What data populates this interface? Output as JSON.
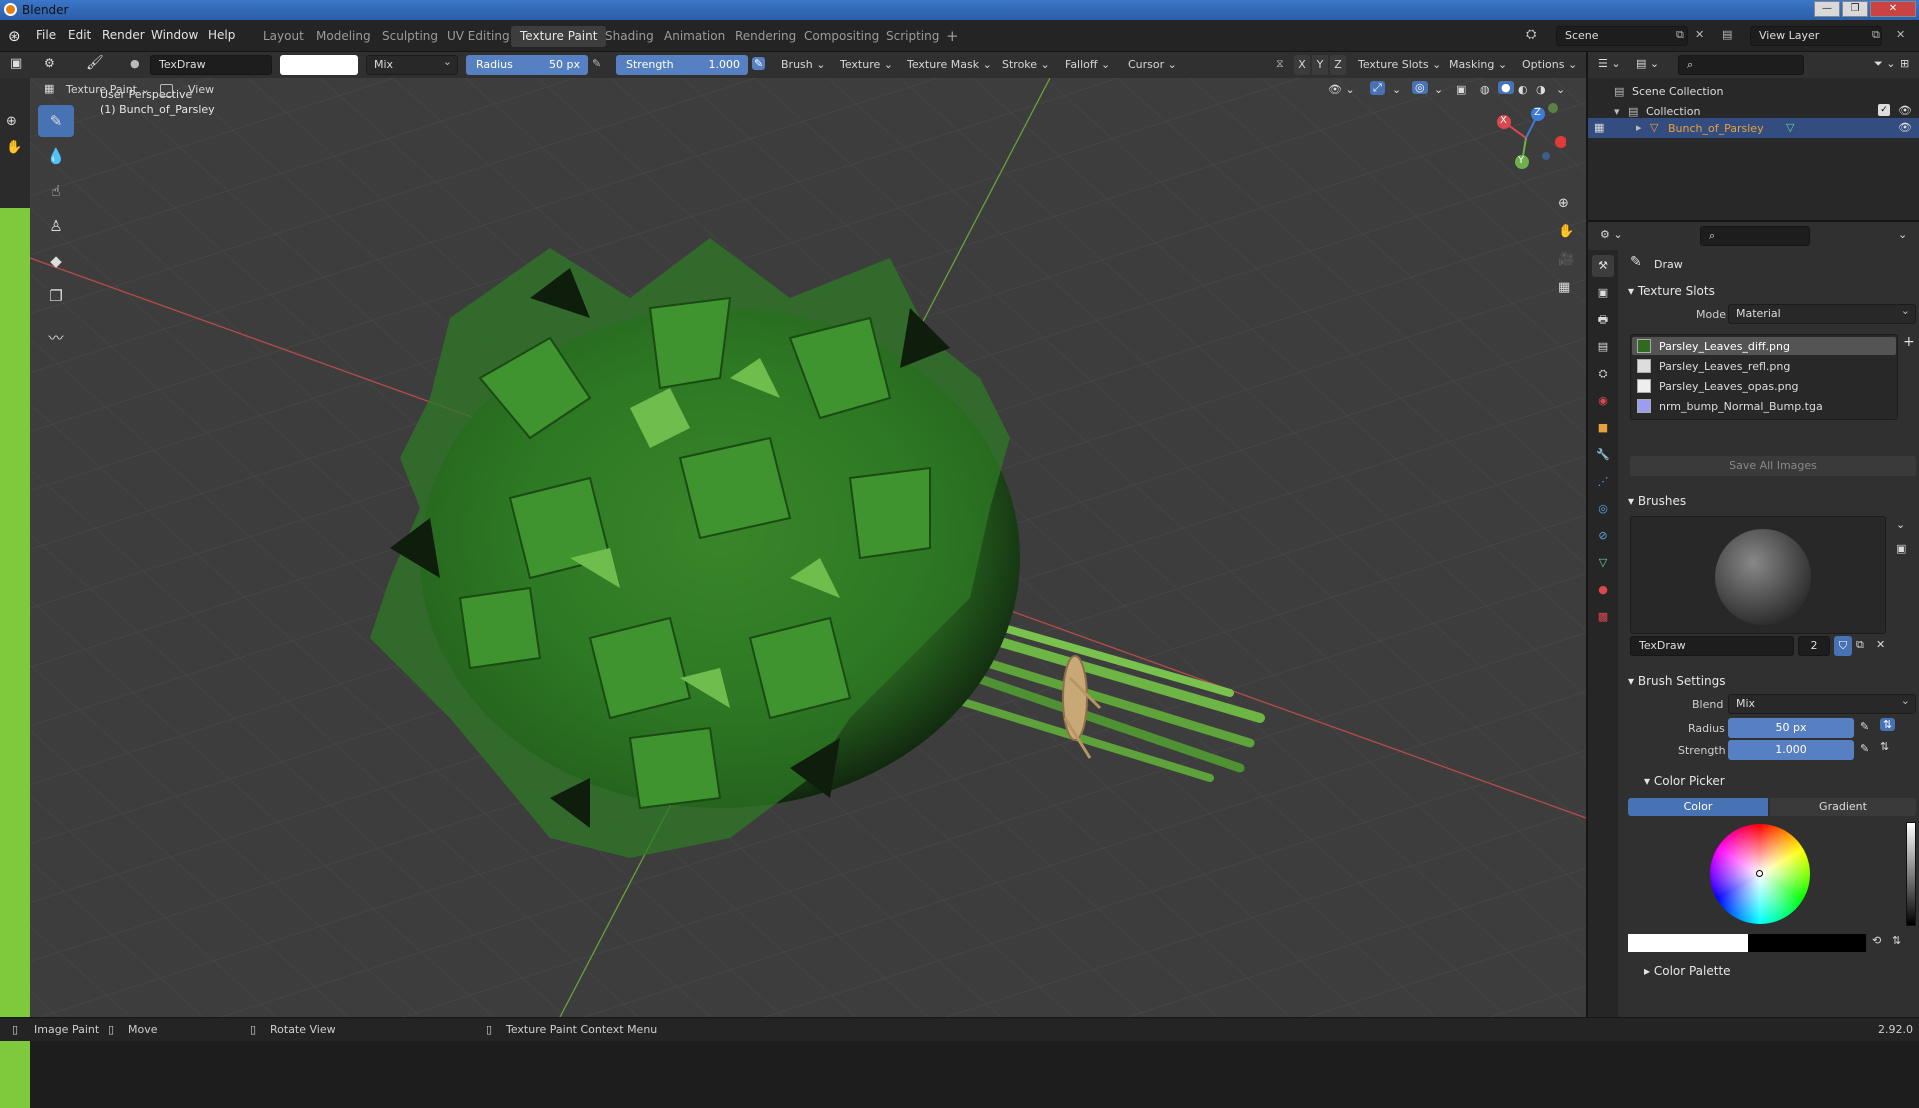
{
  "window": {
    "title": "Blender"
  },
  "menu": [
    "File",
    "Edit",
    "Render",
    "Window",
    "Help"
  ],
  "workspaces": [
    "Layout",
    "Modeling",
    "Sculpting",
    "UV Editing",
    "Texture Paint",
    "Shading",
    "Animation",
    "Rendering",
    "Compositing",
    "Scripting"
  ],
  "active_workspace": "Texture Paint",
  "scene": "Scene",
  "view_layer": "View Layer",
  "toolheader": {
    "brush_name": "TexDraw",
    "blend": "Mix",
    "radius_label": "Radius",
    "radius_value": "50 px",
    "strength_label": "Strength",
    "strength_value": "1.000",
    "menus": [
      "Brush",
      "Texture",
      "Texture Mask",
      "Stroke",
      "Falloff",
      "Cursor"
    ],
    "axes": [
      "X",
      "Y",
      "Z"
    ],
    "right_menus": [
      "Texture Slots",
      "Masking",
      "Options"
    ]
  },
  "viewport_header": {
    "mode": "Texture Paint",
    "view": "View"
  },
  "viewport": {
    "perspective": "User Perspective",
    "object": "(1) Bunch_of_Parsley"
  },
  "gizmo": {
    "x": "X",
    "y": "Y",
    "z": "Z"
  },
  "outliner": {
    "root": "Scene Collection",
    "collection": "Collection",
    "object": "Bunch_of_Parsley"
  },
  "properties": {
    "tool_name": "Draw",
    "texture_slots": {
      "title": "Texture Slots",
      "mode_label": "Mode",
      "mode_value": "Material",
      "slots": [
        "Parsley_Leaves_diff.png",
        "Parsley_Leaves_refl.png",
        "Parsley_Leaves_opas.png",
        "nrm_bump_Normal_Bump.tga"
      ],
      "save_all": "Save All Images"
    },
    "brushes": {
      "title": "Brushes",
      "brush_name": "TexDraw",
      "users": "2"
    },
    "brush_settings": {
      "title": "Brush Settings",
      "blend_label": "Blend",
      "blend_value": "Mix",
      "radius_label": "Radius",
      "radius_value": "50 px",
      "strength_label": "Strength",
      "strength_value": "1.000"
    },
    "color_picker": {
      "title": "Color Picker",
      "tab_color": "Color",
      "tab_gradient": "Gradient"
    },
    "color_palette": {
      "title": "Color Palette"
    }
  },
  "statusbar": {
    "items": [
      "Image Paint",
      "Move",
      "Rotate View",
      "Texture Paint Context Menu"
    ],
    "version": "2.92.0"
  },
  "colors": {
    "accent": "#4772b3",
    "slider": "#5680c2",
    "object_orange": "#e8a13c",
    "x_axis": "#d9474f",
    "y_axis": "#6fb04a",
    "z_axis": "#3d7bd6"
  }
}
